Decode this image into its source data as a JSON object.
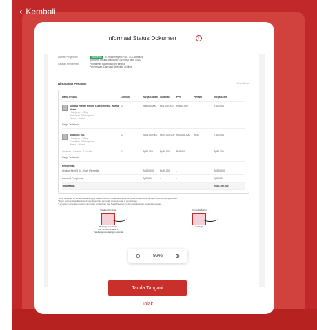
{
  "nav": {
    "back_label": "Kembali"
  },
  "header": {
    "title": "Informasi Status Dokumen",
    "info_icon": "info-icon"
  },
  "document": {
    "address_label": "Alamat Pengiriman",
    "address_tag": "Tokopedia",
    "address_line1": "Jl. Indah Regency No. 37A, Bandung",
    "address_line2": "Bandung Tipsing, Bandung City, West Java 40122",
    "notes_label": "Catatan Pengiriman",
    "notes_line1": "Pengiriman barang secara tunggal",
    "notes_line2": "Penerimaan, Dan saat Berbelok, di Bibig",
    "section_title": "Ringkasan Pesanan",
    "section_link": "Lihat Rincian",
    "headers": [
      "Nama Produk",
      "Jumlah",
      "Harga Satuan",
      "Subtotal",
      "PPN",
      "PPnBM",
      "Harga Akhir"
    ],
    "products": [
      {
        "name": "Sangka Hunter Helium Kulit Sintetis - Warna Hitam",
        "meta1": "• Panjang = 30 kg",
        "meta2": "Penjualan di Tokopedia",
        "meta3": "Warna : Hitam",
        "note": "Harga Terlampir",
        "qty": "1",
        "unit": "Rp6.000.000",
        "subtotal": "Rp6.000.000",
        "ppn": "Rp600.000",
        "ppnbm": "-",
        "final": "6.440.000"
      },
      {
        "name": "Macbook 2021",
        "meta1": "• Panjang = 30 kg",
        "meta2": "Penjualan di Tokopedia",
        "meta3": "Warna : Hitam",
        "note": "Harga Terlampir",
        "qty": "1",
        "unit": "Rp24.000.000",
        "subtotal": "Rp24.000.000",
        "ppn": "Rp2.400.000",
        "ppnbm": "Rp11",
        "final": "2.440.000"
      },
      {
        "name": "Layanan - Garansi - 12 bulan",
        "meta1": "",
        "meta2": "",
        "meta3": "",
        "note": "Harga Terlampir",
        "qty": "1",
        "unit": "Rp50.000",
        "subtotal": "Rp50.000",
        "ppn": "Rp5.000",
        "ppnbm": "-",
        "final": "Rp55.100"
      }
    ],
    "shipping_title": "Pengiriman",
    "shipping_rows": [
      {
        "label": "Ongkos Kirim 5 Kg - Kurir Penyedia",
        "subtotal": "Rp200.000",
        "ppn": "Rp20.000",
        "ppnbm": "-",
        "final": "Rp220.000"
      },
      {
        "label": "Asuransi Pengiriman",
        "subtotal": "Rp2.000",
        "ppn": "-",
        "ppnbm": "-",
        "final": "Rp2.000"
      }
    ],
    "total_label": "Total Harga",
    "total_value": "Rp30.450.000",
    "notes_lines": [
      "*Surat Pesanan ini berlaku sejak tanggal Surat Pesanan ini ditandatangani oleh para pihak sesuai dengan ketentuan yang berlaku.",
      "*Bayar selama data diberikan di bawah periode dan telah tersedia tunai di perusahaan.",
      "*Lampiran merupakan bagian yang tidak terpisahkan dari Surat Pesanan ini dan berlaku sejak penandatanganan."
    ],
    "signer_left_title": "Pejabat Pembuat",
    "signer_left_name": "Dadang Suherman",
    "signer_left_nip": "NIP : 1980031 9200  1",
    "signer_left_sub": "Pejabat penandatangan kontrak",
    "signer_right_title": "Penyedia Sabut",
    "signer_right_name": "Kemeja"
  },
  "zoom": {
    "minus": "⊖",
    "value": "92%",
    "plus": "⊕"
  },
  "actions": {
    "sign_label": "Tanda Tangani",
    "reject_label": "Tolak"
  },
  "colors": {
    "brand": "#c0282a",
    "stamp": "#f6d0d8"
  }
}
